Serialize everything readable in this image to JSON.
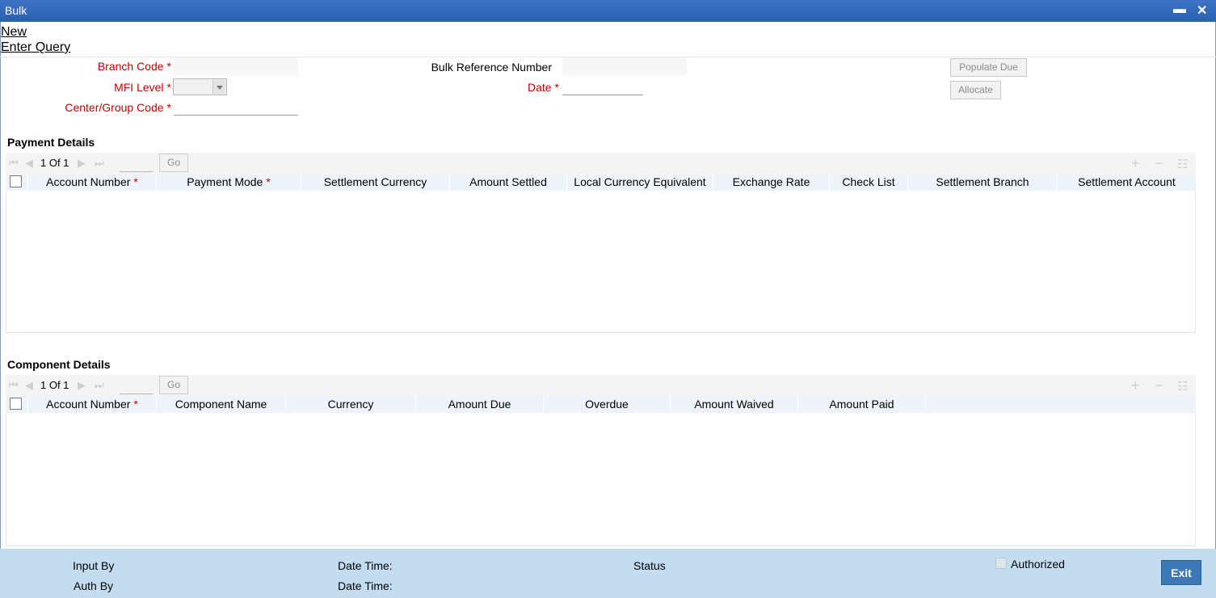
{
  "window": {
    "title": "Bulk",
    "minimize": "▬",
    "close": "✕"
  },
  "menu": {
    "new": "New",
    "enter_query": "Enter Query"
  },
  "form": {
    "branch_code_label": "Branch Code",
    "mfi_level_label": "MFI Level",
    "center_group_label": "Center/Group Code",
    "bulk_ref_label": "Bulk Reference Number",
    "date_label": "Date",
    "required_mark": "*",
    "populate_due": "Populate Due",
    "allocate": "Allocate"
  },
  "payment": {
    "title": "Payment Details",
    "pager": "1 Of 1",
    "go": "Go",
    "columns": [
      "Account Number",
      "Payment Mode",
      "Settlement Currency",
      "Amount Settled",
      "Local Currency Equivalent",
      "Exchange Rate",
      "Check List",
      "Settlement Branch",
      "Settlement Account"
    ],
    "required": [
      "*",
      "*"
    ]
  },
  "component": {
    "title": "Component Details",
    "pager": "1 Of 1",
    "go": "Go",
    "columns": [
      "Account Number",
      "Component Name",
      "Currency",
      "Amount Due",
      "Overdue",
      "Amount Waived",
      "Amount Paid"
    ],
    "required": [
      "*"
    ]
  },
  "icons": {
    "first": "⏮",
    "prev": "◀",
    "next": "▶",
    "last": "⏭",
    "add": "+",
    "remove": "−",
    "list": "☷"
  },
  "footer": {
    "input_by": "Input By",
    "auth_by": "Auth By",
    "date_time_1": "Date Time:",
    "date_time_2": "Date Time:",
    "status": "Status",
    "authorized": "Authorized",
    "exit": "Exit"
  },
  "colors": {
    "titlebar": "#2a5fb0",
    "required": "#c40000",
    "footer": "#c3dcf0",
    "exit_button": "#3c78b5"
  }
}
